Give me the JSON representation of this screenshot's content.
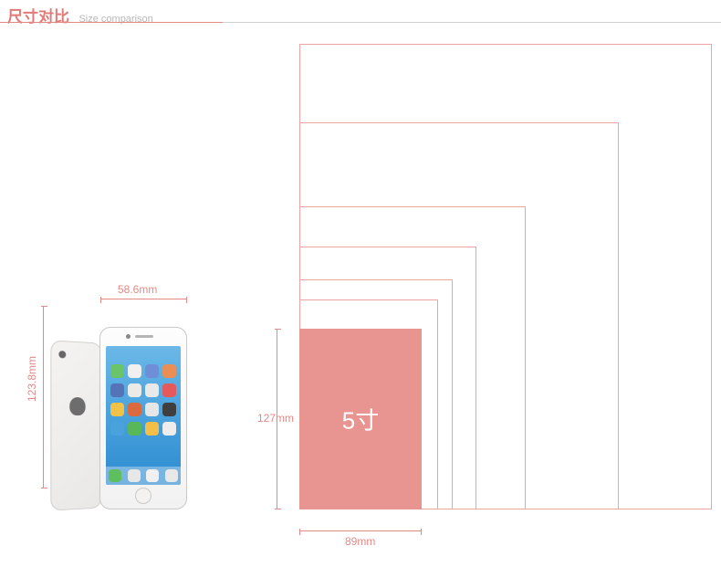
{
  "header": {
    "title_cn": "尺寸对比",
    "title_en": "Size comparison"
  },
  "phone": {
    "width_label": "58.6mm",
    "height_label": "123.8mm"
  },
  "highlighted_box": {
    "label": "5寸",
    "height_label": "127mm",
    "width_label": "89mm"
  },
  "chart_data": {
    "type": "diagram",
    "title": "尺寸对比 Size comparison",
    "reference_device": {
      "name": "iPhone 5s",
      "width_mm": 58.6,
      "height_mm": 123.8
    },
    "highlighted": {
      "size_inch": 5,
      "width_mm": 89,
      "height_mm": 127
    },
    "nested_outlines_count": 6,
    "notes": "Concentric size rectangles share bottom-left origin; filled pink rectangle is the 5-inch reference (89×127mm). Outer outlines represent progressively larger photo/print sizes (6 outlines beyond the filled box)."
  }
}
